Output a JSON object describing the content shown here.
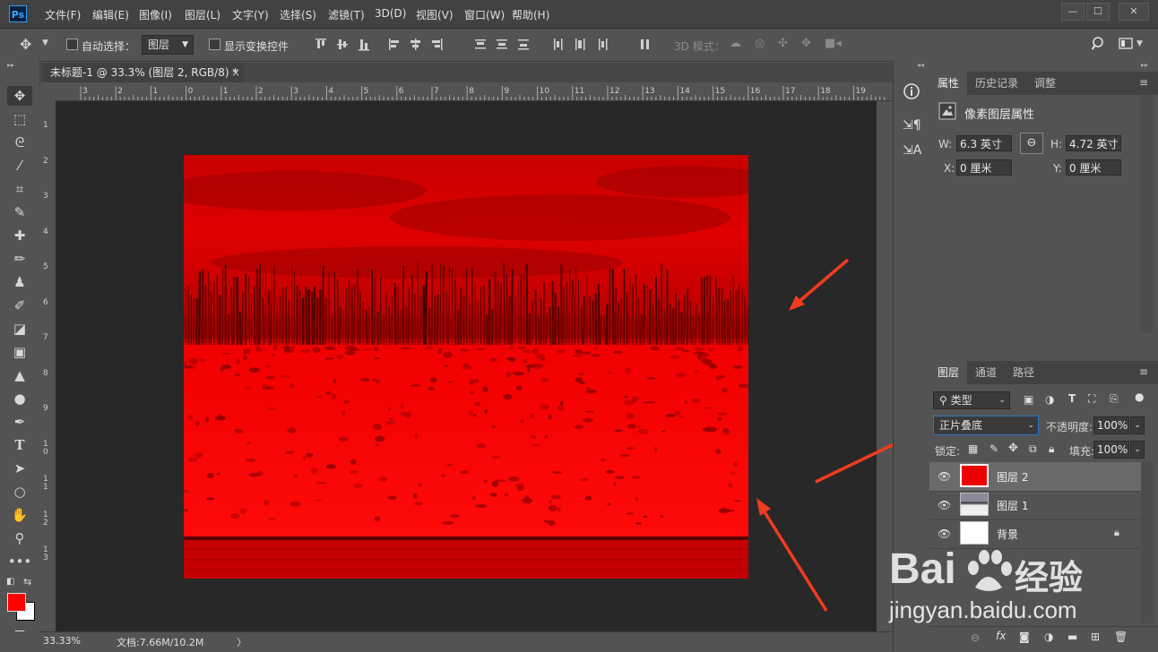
{
  "app": {
    "logo": "Ps",
    "menu": [
      "文件(F)",
      "编辑(E)",
      "图像(I)",
      "图层(L)",
      "文字(Y)",
      "选择(S)",
      "滤镜(T)",
      "3D(D)",
      "视图(V)",
      "窗口(W)",
      "帮助(H)"
    ],
    "window_buttons": [
      "—",
      "☐",
      "✕"
    ]
  },
  "options": {
    "auto_select_label": "自动选择：",
    "auto_select_value": "图层",
    "show_transform_label": "显示变换控件",
    "mode_3d_label": "3D 模式："
  },
  "document": {
    "tab_title": "未标题-1 @ 33.3% (图层 2, RGB/8) *",
    "tab_close": "×",
    "ruler_top": [
      "3",
      "2",
      "1",
      "0",
      "1",
      "2",
      "3",
      "4",
      "5",
      "6",
      "7",
      "8",
      "9",
      "10",
      "11",
      "12",
      "13",
      "14",
      "15",
      "16",
      "17",
      "18",
      "19"
    ],
    "ruler_left": [
      "1",
      "2",
      "3",
      "4",
      "5",
      "6",
      "7",
      "8",
      "9",
      "1\n0",
      "1\n1",
      "1\n2",
      "1\n3"
    ]
  },
  "status": {
    "zoom": "33.33%",
    "doc_info": "文档:7.66M/10.2M",
    "arrow": "〉"
  },
  "properties": {
    "tabs": [
      "属性",
      "历史记录",
      "调整"
    ],
    "title": "像素图层属性",
    "w_label": "W:",
    "w_value": "6.3 英寸",
    "h_label": "H:",
    "h_value": "4.72 英寸",
    "x_label": "X:",
    "x_value": "0 厘米",
    "y_label": "Y:",
    "y_value": "0 厘米"
  },
  "layers": {
    "tabs": [
      "图层",
      "通道",
      "路径"
    ],
    "filter_value": "类型",
    "blend_mode": "正片叠底",
    "opacity_label": "不透明度:",
    "opacity_value": "100%",
    "lock_label": "锁定:",
    "fill_label": "填充:",
    "fill_value": "100%",
    "items": [
      {
        "name": "图层 2",
        "selected": true
      },
      {
        "name": "图层 1",
        "selected": false
      },
      {
        "name": "背景",
        "selected": false
      }
    ]
  },
  "watermark": {
    "line1": "Bai",
    "line1b": "经验",
    "line2": "jingyan.baidu.com"
  },
  "colors": {
    "foreground": "#ff0000",
    "background": "#ffffff",
    "image_red": "#e60000",
    "annotation_arrow": "#f03b20"
  }
}
